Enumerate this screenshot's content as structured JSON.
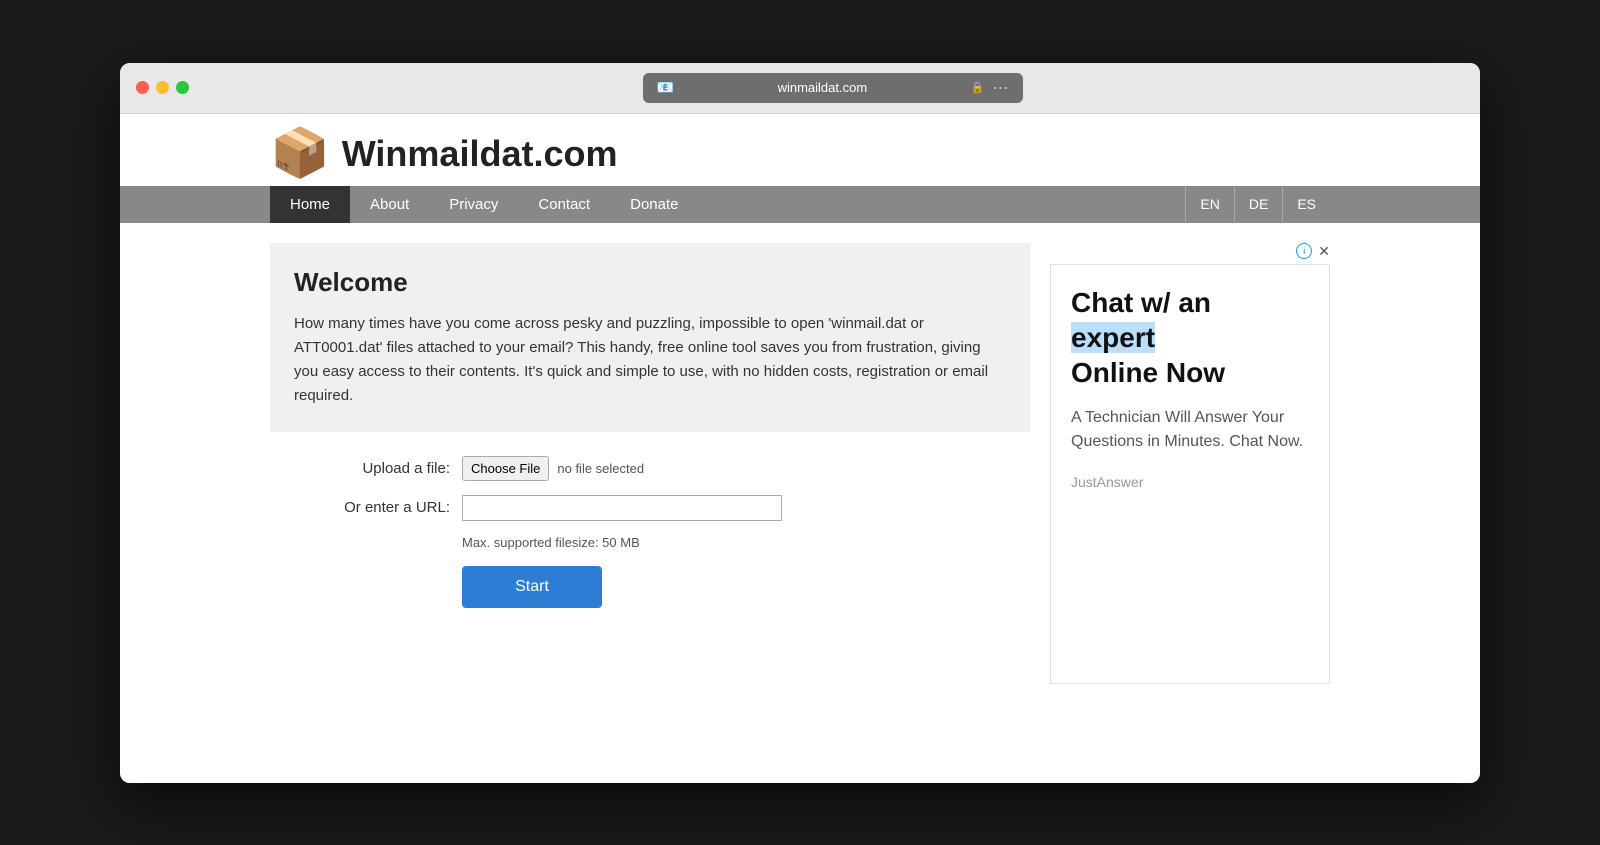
{
  "browser": {
    "favicon": "📧",
    "url": "winmaildat.com",
    "lock": "🔒",
    "menu": "⋯"
  },
  "site": {
    "logo": "📦",
    "title": "Winmaildat.com"
  },
  "nav": {
    "items": [
      {
        "label": "Home",
        "active": true
      },
      {
        "label": "About",
        "active": false
      },
      {
        "label": "Privacy",
        "active": false
      },
      {
        "label": "Contact",
        "active": false
      },
      {
        "label": "Donate",
        "active": false
      }
    ],
    "languages": [
      {
        "label": "EN"
      },
      {
        "label": "DE"
      },
      {
        "label": "ES"
      }
    ]
  },
  "welcome": {
    "title": "Welcome",
    "body": "How many times have you come across pesky and puzzling, impossible to open 'winmail.dat or ATT0001.dat' files attached to your email? This handy, free online tool saves you from frustration, giving you easy access to their contents. It's quick and simple to use, with no hidden costs, registration or email required."
  },
  "form": {
    "upload_label": "Upload a file:",
    "choose_file_label": "Choose File",
    "no_file_label": "no file selected",
    "url_label": "Or enter a URL:",
    "url_placeholder": "",
    "max_size": "Max. supported filesize: 50 MB",
    "start_button": "Start"
  },
  "ad": {
    "headline_part1": "Chat w/ an",
    "headline_highlight": "expert",
    "headline_part2": "Online Now",
    "subtext": "A Technician Will Answer Your Questions in Minutes. Chat Now.",
    "source": "JustAnswer"
  }
}
